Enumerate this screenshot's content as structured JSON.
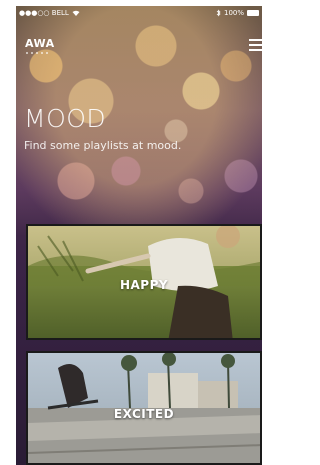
{
  "status_bar": {
    "carrier": "●●●○○ BELL",
    "battery": "100%"
  },
  "header": {
    "logo": "AWA"
  },
  "hero": {
    "title": "MOOD",
    "subtitle": "Find some playlists at mood."
  },
  "moods": [
    {
      "label": "HAPPY"
    },
    {
      "label": "EXCITED"
    }
  ]
}
